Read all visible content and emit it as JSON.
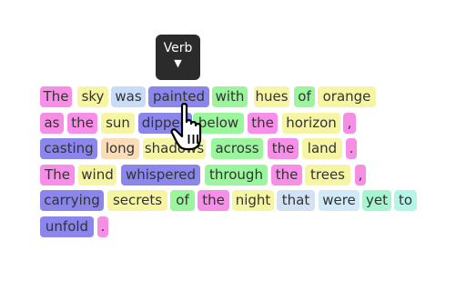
{
  "tooltip": {
    "label": "Verb",
    "arrow": "▼"
  },
  "cursor": {
    "icon": "hand-pointer-icon"
  },
  "colors": {
    "DET": "#f78fe9",
    "NOUN": "#f5f5a4",
    "VERB": "#8b86ec",
    "AUX": "#c8dcf7",
    "ADP": "#9af59d",
    "PUNCT": "#f68ee6",
    "PRON": "#d2e2f4",
    "ADV": "#a6f5cf",
    "PART": "#b5f5e8",
    "ADJ": "#fbdcb9",
    "CCONJ": "#d0ebf7"
  },
  "lines": [
    [
      {
        "text": "The",
        "pos": "DET"
      },
      {
        "text": "sky",
        "pos": "NOUN"
      },
      {
        "text": "was",
        "pos": "AUX"
      },
      {
        "text": "painted",
        "pos": "VERB"
      },
      {
        "text": "with",
        "pos": "ADP"
      },
      {
        "text": "hues",
        "pos": "NOUN"
      },
      {
        "text": "of",
        "pos": "ADP"
      },
      {
        "text": "orange",
        "pos": "NOUN"
      }
    ],
    [
      {
        "text": "as",
        "pos": "PUNCT"
      },
      {
        "text": "the",
        "pos": "DET"
      },
      {
        "text": "sun",
        "pos": "NOUN"
      },
      {
        "text": "dipped",
        "pos": "VERB"
      },
      {
        "text": "below",
        "pos": "ADP"
      },
      {
        "text": "the",
        "pos": "DET"
      },
      {
        "text": "horizon",
        "pos": "NOUN"
      },
      {
        "text": ",",
        "pos": "PUNCT"
      }
    ],
    [
      {
        "text": "casting",
        "pos": "VERB"
      },
      {
        "text": "long",
        "pos": "ADJ"
      },
      {
        "text": "shadows",
        "pos": "NOUN"
      },
      {
        "text": "across",
        "pos": "ADP"
      },
      {
        "text": "the",
        "pos": "DET"
      },
      {
        "text": "land",
        "pos": "NOUN"
      },
      {
        "text": ".",
        "pos": "PUNCT"
      }
    ],
    [
      {
        "text": "The",
        "pos": "DET"
      },
      {
        "text": "wind",
        "pos": "NOUN"
      },
      {
        "text": "whispered",
        "pos": "VERB"
      },
      {
        "text": "through",
        "pos": "ADP"
      },
      {
        "text": "the",
        "pos": "DET"
      },
      {
        "text": "trees",
        "pos": "NOUN"
      },
      {
        "text": ",",
        "pos": "PUNCT"
      }
    ],
    [
      {
        "text": "carrying",
        "pos": "VERB"
      },
      {
        "text": "secrets",
        "pos": "NOUN"
      },
      {
        "text": "of",
        "pos": "ADP"
      },
      {
        "text": "the",
        "pos": "DET"
      },
      {
        "text": "night",
        "pos": "NOUN"
      },
      {
        "text": "that",
        "pos": "PRON"
      },
      {
        "text": "were",
        "pos": "CCONJ"
      },
      {
        "text": "yet",
        "pos": "ADV"
      },
      {
        "text": "to",
        "pos": "PART"
      }
    ],
    [
      {
        "text": "unfold",
        "pos": "VERB"
      },
      {
        "text": ".",
        "pos": "PUNCT"
      }
    ]
  ]
}
